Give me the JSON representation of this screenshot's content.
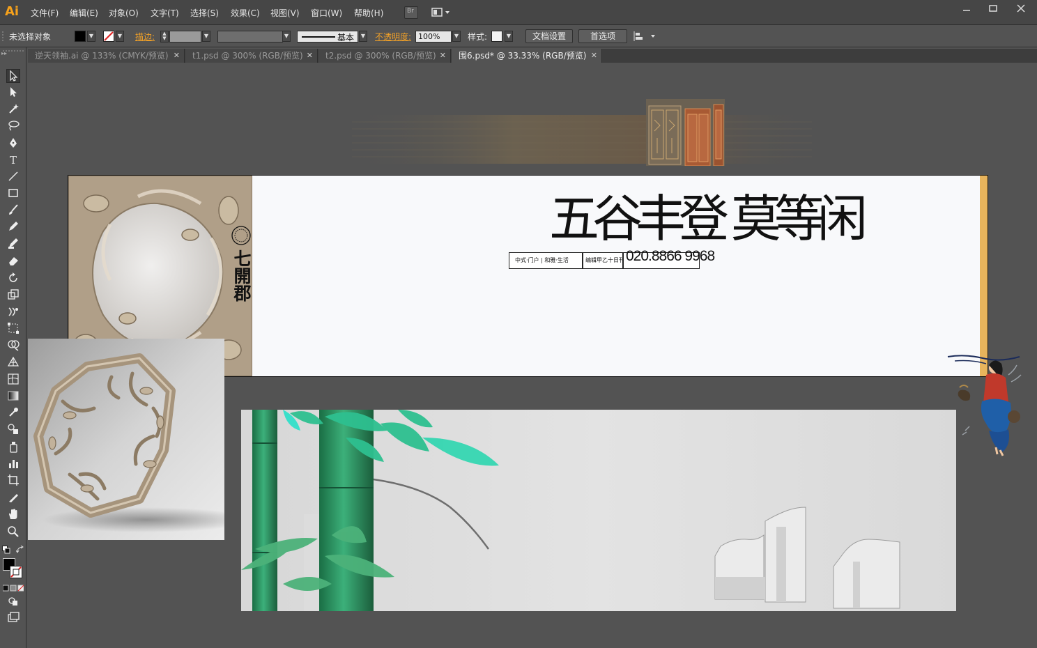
{
  "app": {
    "logo": "Ai"
  },
  "menu": {
    "items": [
      "文件(F)",
      "编辑(E)",
      "对象(O)",
      "文字(T)",
      "选择(S)",
      "效果(C)",
      "视图(V)",
      "窗口(W)",
      "帮助(H)"
    ],
    "bridge_icon": "Br"
  },
  "controlbar": {
    "selection": "未选择对象",
    "stroke_label": "描边:",
    "stroke_style": "基本",
    "opacity_label": "不透明度:",
    "opacity_value": "100%",
    "style_label": "样式:",
    "doc_setup": "文档设置",
    "preferences": "首选项"
  },
  "tabs": [
    {
      "label": "逆天领袖.ai @ 133% (CMYK/预览)",
      "active": false
    },
    {
      "label": "t1.psd @ 300% (RGB/预览)",
      "active": false
    },
    {
      "label": "t2.psd @ 300% (RGB/预览)",
      "active": false
    },
    {
      "label": "围6.psd* @ 33.33% (RGB/预览)",
      "active": true
    }
  ],
  "artboard": {
    "headline": "五谷丰登 莫等闲",
    "vertical_brand": "七開郡",
    "phone": "020.8866 9968",
    "info_box_1": "中式·门户 | 和雅·生活",
    "info_box_2": "编辑甲乙十日刊"
  },
  "icons": [
    "selection-tool-icon",
    "direct-selection-icon",
    "magic-wand-icon",
    "lasso-icon",
    "pen-icon",
    "type-icon",
    "line-icon",
    "rectangle-icon",
    "paintbrush-icon",
    "pencil-icon",
    "blob-brush-icon",
    "eraser-icon",
    "rotate-icon",
    "scale-icon",
    "warp-icon",
    "free-transform-icon",
    "shape-builder-icon",
    "perspective-icon",
    "mesh-icon",
    "gradient-icon",
    "eyedropper-icon",
    "blend-icon",
    "symbol-sprayer-icon",
    "graph-icon",
    "artboard-icon",
    "slice-icon",
    "hand-icon",
    "zoom-icon"
  ],
  "colors": {
    "ui_dark": "#535353",
    "menu_bg": "#464646",
    "accent_orange": "#f0a028",
    "artboard_bg": "#f8f9fb",
    "bamboo_green": "#2fa36b",
    "gold_strip": "#e8b45c"
  }
}
